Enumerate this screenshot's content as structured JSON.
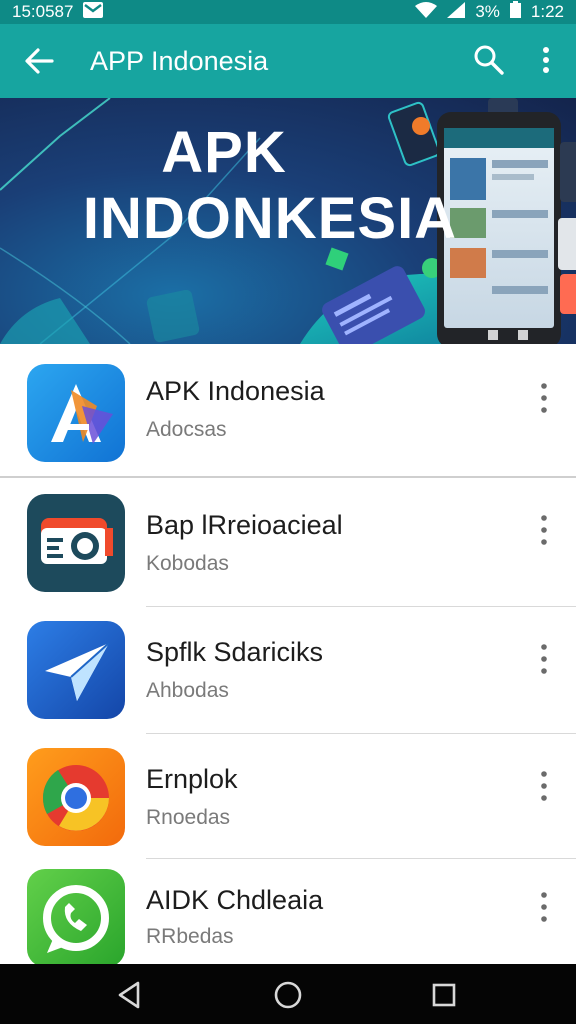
{
  "status_bar": {
    "time_left": "15:0587",
    "battery": "3%",
    "time_right": "1:22"
  },
  "app_bar": {
    "title": "APP Indonesia"
  },
  "banner": {
    "line1": "APK",
    "line2": "INDONKESIA"
  },
  "apps": [
    {
      "name": "APK Indonesia",
      "subtitle": "Adocsas"
    },
    {
      "name": "Bap lRreioacieal",
      "subtitle": "Kobodas"
    },
    {
      "name": "Spflk Sdariciks",
      "subtitle": "Ahbodas"
    },
    {
      "name": "Ernplok",
      "subtitle": "Rnoedas"
    },
    {
      "name": "AIDK Chdleaia",
      "subtitle": "RRbedas"
    }
  ],
  "colors": {
    "status_bar": "#0e8a86",
    "app_bar": "#17a5a0",
    "nav_bar": "#050505"
  },
  "icons": [
    "back-arrow-icon",
    "search-icon",
    "more-vert-icon",
    "gmail-icon",
    "wifi-icon",
    "signal-icon",
    "battery-icon",
    "back-nav-icon",
    "home-nav-icon",
    "recents-nav-icon"
  ]
}
